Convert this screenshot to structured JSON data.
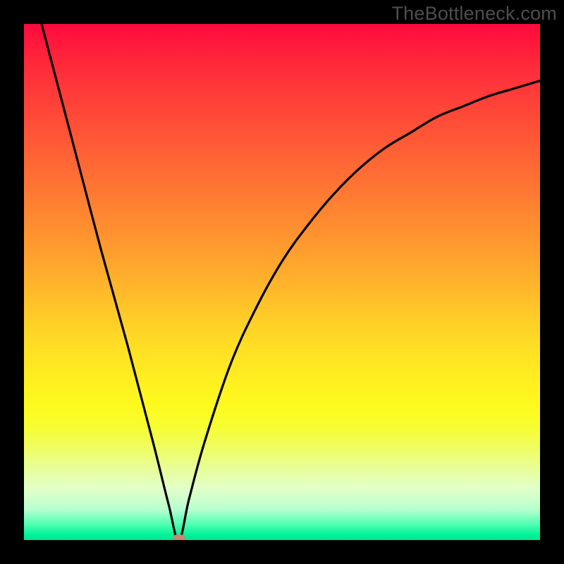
{
  "watermark": "TheBottleneck.com",
  "colors": {
    "background": "#000000",
    "curve": "#000000",
    "dot": "#cc8572"
  },
  "chart_data": {
    "type": "line",
    "title": "",
    "xlabel": "",
    "ylabel": "",
    "xlim": [
      0,
      100
    ],
    "ylim": [
      0,
      100
    ],
    "annotations": [
      {
        "name": "bottleneck-marker",
        "x": 30,
        "y": 0
      }
    ],
    "series": [
      {
        "name": "bottleneck-curve",
        "x": [
          0,
          5,
          10,
          15,
          20,
          25,
          28,
          30,
          32,
          35,
          40,
          45,
          50,
          55,
          60,
          65,
          70,
          75,
          80,
          85,
          90,
          95,
          100
        ],
        "values": [
          113,
          94,
          75,
          56,
          38,
          19,
          7,
          0,
          8,
          19,
          34,
          45,
          54,
          61,
          67,
          72,
          76,
          79,
          82,
          84,
          86,
          87.5,
          89
        ]
      }
    ]
  }
}
